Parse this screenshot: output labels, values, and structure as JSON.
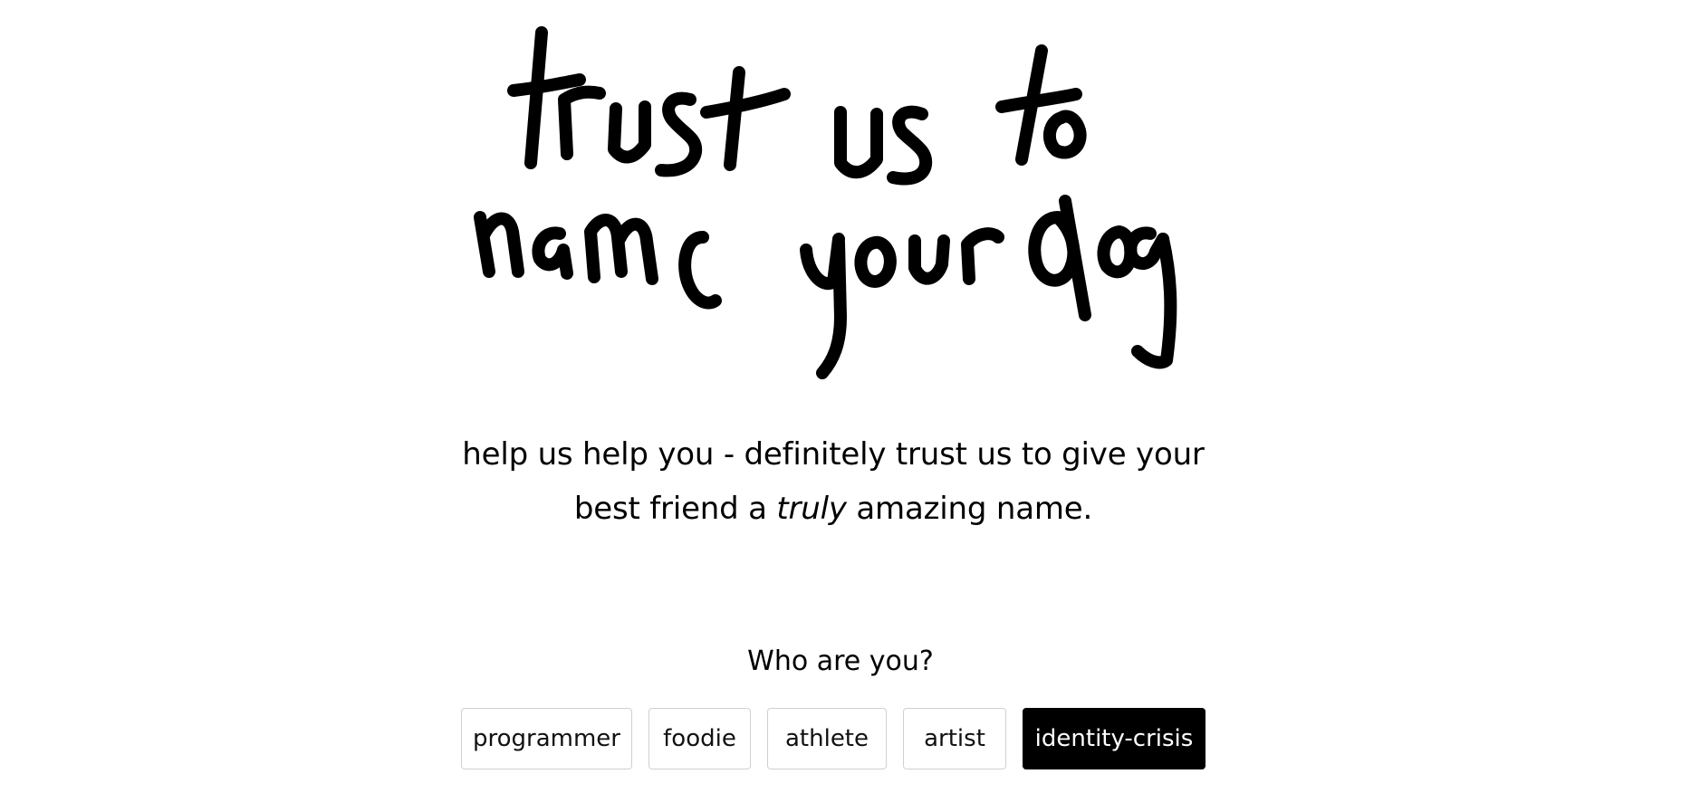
{
  "hero": {
    "title": "trust us to name your dog"
  },
  "tagline": {
    "line1": "help us help you - definitely trust us to give your",
    "line2_before": "best friend a ",
    "line2_emph": "truly",
    "line2_after": " amazing name."
  },
  "question": {
    "label": "Who are you?"
  },
  "choices": [
    {
      "label": "programmer",
      "selected": false
    },
    {
      "label": "foodie",
      "selected": false
    },
    {
      "label": "athlete",
      "selected": false
    },
    {
      "label": "artist",
      "selected": false
    },
    {
      "label": "identity-crisis",
      "selected": true
    }
  ],
  "colors": {
    "text": "#000000",
    "background": "#ffffff",
    "selected_bg": "#000000",
    "selected_text": "#ffffff",
    "border": "#d0d0d0"
  }
}
